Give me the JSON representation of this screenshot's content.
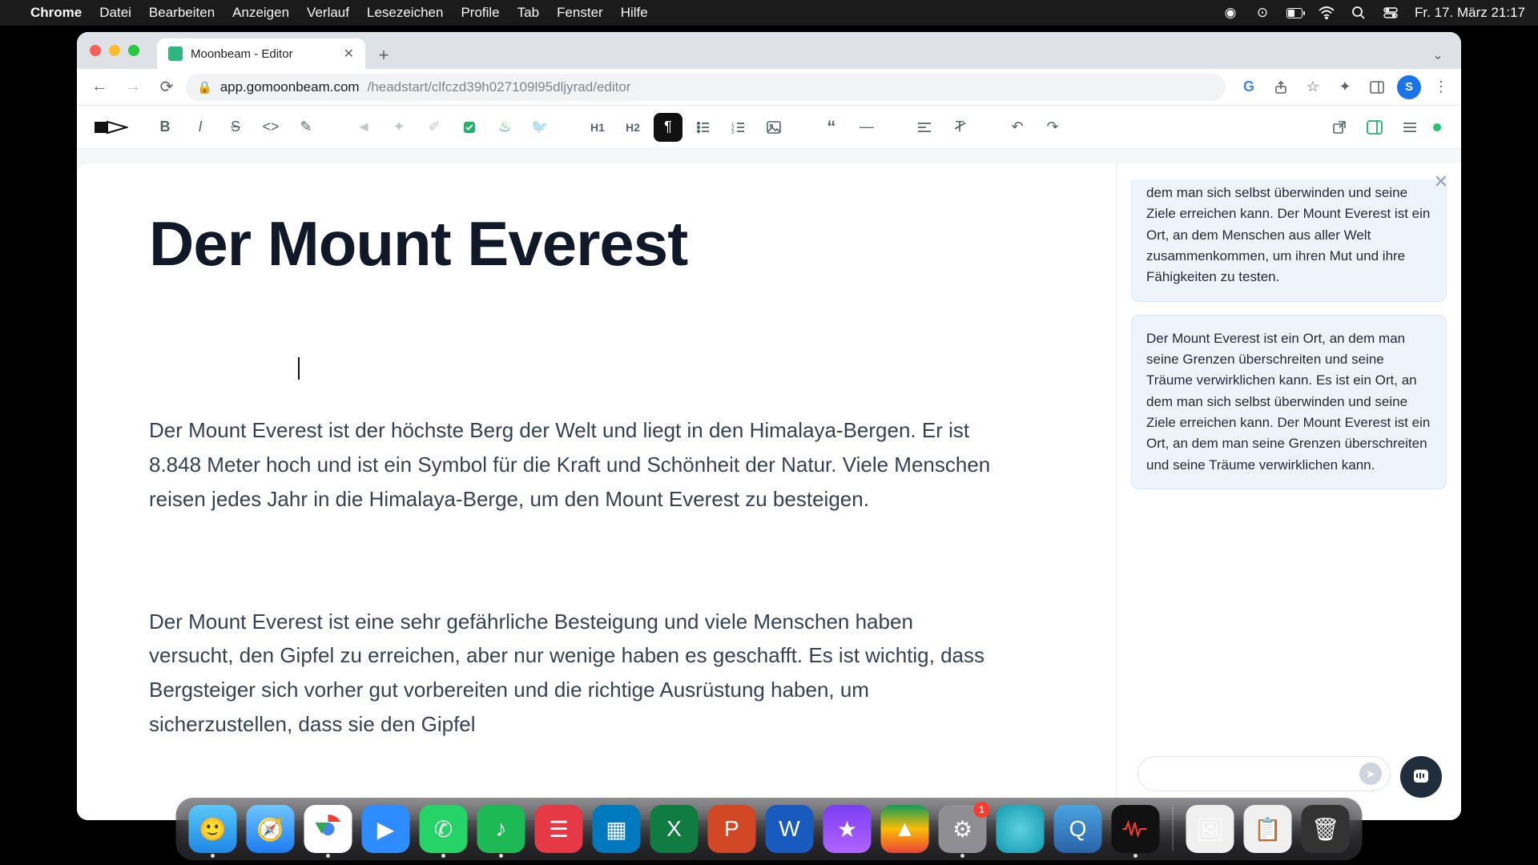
{
  "menubar": {
    "app": "Chrome",
    "items": [
      "Datei",
      "Bearbeiten",
      "Anzeigen",
      "Verlauf",
      "Lesezeichen",
      "Profile",
      "Tab",
      "Fenster",
      "Hilfe"
    ],
    "clock": "Fr. 17. März 21:17"
  },
  "browser": {
    "tab_title": "Moonbeam - Editor",
    "url_host": "app.gomoonbeam.com",
    "url_path": "/headstart/clfczd39h027109l95dljyrad/editor",
    "avatar_initial": "S"
  },
  "toolbar": {
    "bold": "B",
    "italic": "I",
    "strike": "S",
    "h1": "H1",
    "h2": "H2"
  },
  "document": {
    "title": "Der Mount Everest",
    "p1": "Der Mount Everest ist der höchste Berg der Welt und liegt in den Himalaya-Bergen. Er ist 8.848 Meter hoch und ist ein Symbol für die Kraft und Schönheit der Natur. Viele Menschen reisen jedes Jahr in die Himalaya-Berge, um den Mount Everest zu besteigen.",
    "p2": "Der Mount Everest ist eine sehr gefährliche Besteigung und viele Menschen haben versucht, den Gipfel zu erreichen, aber nur wenige haben es geschafft. Es ist wichtig, dass Bergsteiger sich vorher gut vorbereiten und die richtige Ausrüstung haben, um sicherzustellen, dass sie den Gipfel"
  },
  "sidebar": {
    "s1": "dem man sich selbst überwinden und seine Ziele erreichen kann. Der Mount Everest ist ein Ort, an dem Menschen aus aller Welt zusammenkommen, um ihren Mut und ihre Fähigkeiten zu testen.",
    "s2": "Der Mount Everest ist ein Ort, an dem man seine Grenzen überschreiten und seine Träume verwirklichen kann. Es ist ein Ort, an dem man sich selbst überwinden und seine Ziele erreichen kann. Der Mount Everest ist ein Ort, an dem man seine Grenzen überschreiten und seine Träume verwirklichen kann."
  },
  "dock": {
    "badge_settings": "1"
  }
}
